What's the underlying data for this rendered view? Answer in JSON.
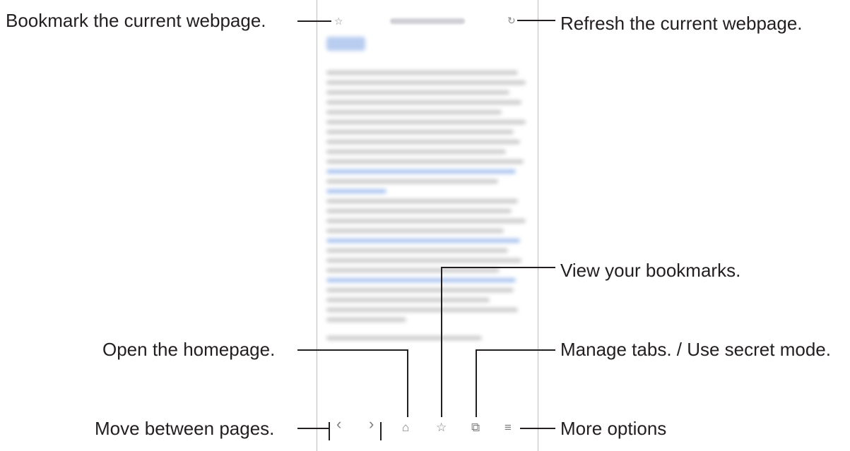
{
  "callouts": {
    "bookmark_page": "Bookmark the current webpage.",
    "refresh": "Refresh the current webpage.",
    "view_bookmarks": "View your bookmarks.",
    "homepage": "Open the homepage.",
    "manage_tabs": "Manage tabs. / Use secret mode.",
    "move_pages": "Move between pages.",
    "more_options": "More options"
  },
  "icons": {
    "bookmark_star": "☆",
    "refresh": "↻",
    "back": "‹",
    "forward": "›",
    "home": "⌂",
    "bookmarks": "☆",
    "tabs": "⧉",
    "menu": "≡"
  },
  "colors": {
    "text": "#231f20",
    "leader": "#231f20",
    "icon": "#7d7d7d",
    "blur_link": "#a9c2ee"
  }
}
